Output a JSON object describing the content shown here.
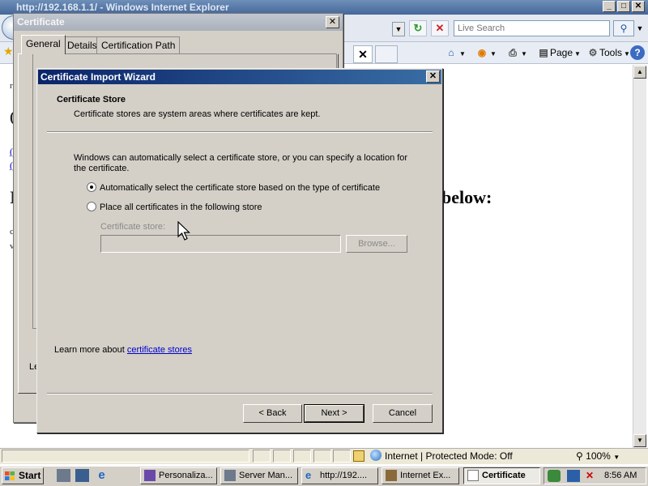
{
  "ie": {
    "title": "http://192.168.1.1/ - Windows Internet Explorer",
    "search_placeholder": "Live Search",
    "commands": {
      "page": "Page",
      "tools": "Tools"
    },
    "status": {
      "zone": "Internet | Protected Mode: Off",
      "zoom": "100%"
    },
    "page_heading_fragment": "below:"
  },
  "cert_dialog": {
    "title": "Certificate",
    "tabs": [
      "General",
      "Details",
      "Certification Path"
    ],
    "learn_stub": "Le"
  },
  "wizard": {
    "title": "Certificate Import Wizard",
    "step_title": "Certificate Store",
    "step_desc": "Certificate stores are system areas where certificates are kept.",
    "intro": "Windows can automatically select a certificate store, or you can specify a location for the certificate.",
    "option_auto": "Automatically select the certificate store based on the type of certificate",
    "option_place": "Place all certificates in the following store",
    "store_label": "Certificate store:",
    "store_value": "",
    "browse": "Browse...",
    "learn_prefix": "Learn more about ",
    "learn_link": "certificate stores",
    "back": "< Back",
    "next": "Next >",
    "cancel": "Cancel",
    "selected_option": "auto"
  },
  "taskbar": {
    "start": "Start",
    "tasks": [
      "Personaliza...",
      "Server Man...",
      "http://192....",
      "Internet Ex...",
      "Certificate"
    ],
    "clock": "8:56 AM"
  }
}
